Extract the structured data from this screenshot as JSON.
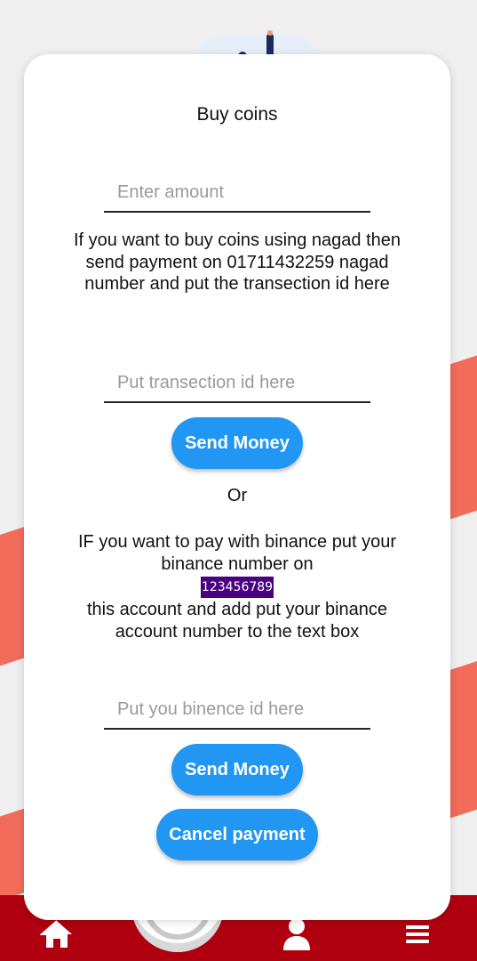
{
  "dialog": {
    "title": "Buy coins",
    "amount_placeholder": "Enter amount",
    "nagad_instructions": "If you want to buy coins using nagad then send payment on 01711432259 nagad number and put the transection id here",
    "transaction_placeholder": "Put transection id here",
    "send_money_label": "Send Money",
    "or_label": "Or",
    "binance_instructions_line1": "IF you want to pay with binance put your binance number on",
    "binance_number": "123456789",
    "binance_instructions_line2": "this account and add put your binance account number to the text box",
    "binance_placeholder": "Put you binence id here",
    "send_money_label_2": "Send Money",
    "cancel_label": "Cancel payment"
  },
  "bottom_nav": {
    "items": [
      {
        "icon": "home-icon"
      },
      {
        "icon": "center-action"
      },
      {
        "icon": "profile-icon"
      },
      {
        "icon": "menu-icon"
      }
    ]
  },
  "colors": {
    "accent": "#2196f3",
    "nav_bar": "#b0000f",
    "stripe": "#f26b5b",
    "highlight": "#4b0082"
  }
}
